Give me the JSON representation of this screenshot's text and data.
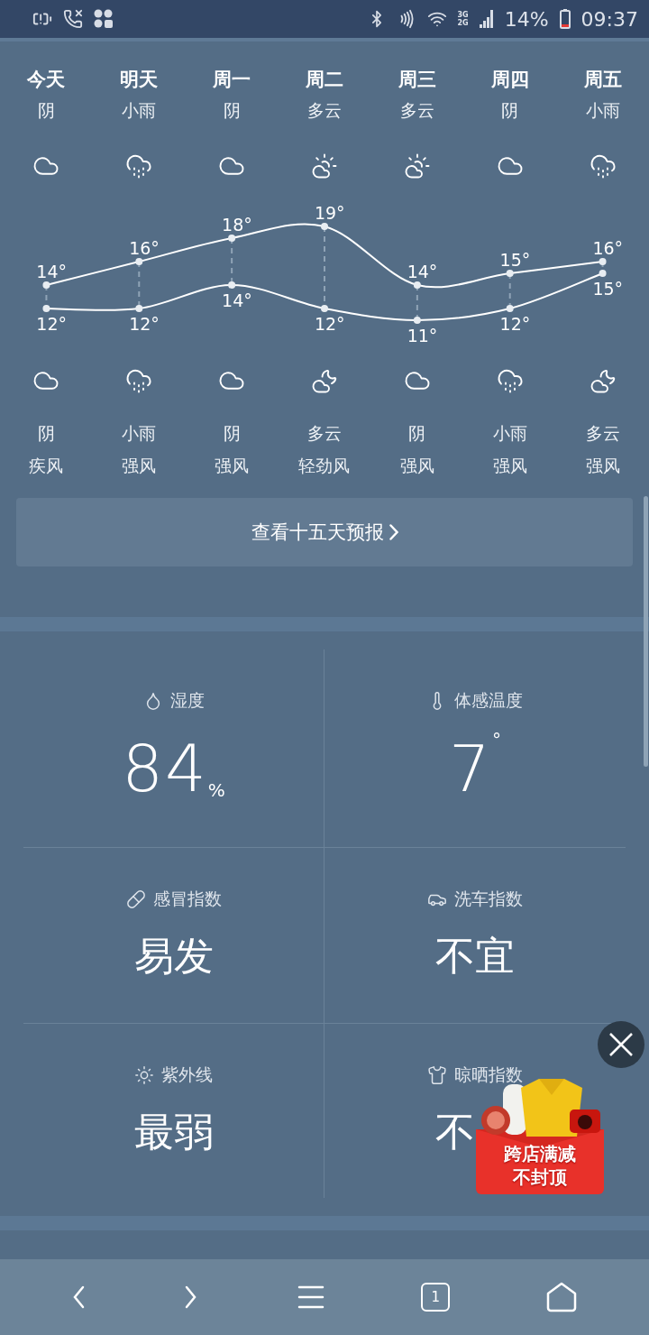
{
  "status_bar": {
    "network_labels": [
      "3G",
      "2G"
    ],
    "battery": "14%",
    "time": "09:37"
  },
  "forecast": {
    "days": [
      {
        "name": "今天",
        "day": {
          "weather": "阴",
          "kind": "cloudy"
        },
        "night": {
          "weather": "阴",
          "kind": "cloudy"
        },
        "wind": "疾风"
      },
      {
        "name": "明天",
        "day": {
          "weather": "小雨",
          "kind": "rain"
        },
        "night": {
          "weather": "小雨",
          "kind": "rain"
        },
        "wind": "强风"
      },
      {
        "name": "周一",
        "day": {
          "weather": "阴",
          "kind": "cloudy"
        },
        "night": {
          "weather": "阴",
          "kind": "cloudy"
        },
        "wind": "强风"
      },
      {
        "name": "周二",
        "day": {
          "weather": "多云",
          "kind": "partly-sun"
        },
        "night": {
          "weather": "多云",
          "kind": "partly-moon"
        },
        "wind": "轻劲风"
      },
      {
        "name": "周三",
        "day": {
          "weather": "多云",
          "kind": "partly-sun"
        },
        "night": {
          "weather": "阴",
          "kind": "cloudy"
        },
        "wind": "强风"
      },
      {
        "name": "周四",
        "day": {
          "weather": "阴",
          "kind": "cloudy"
        },
        "night": {
          "weather": "小雨",
          "kind": "rain"
        },
        "wind": "强风"
      },
      {
        "name": "周五",
        "day": {
          "weather": "小雨",
          "kind": "rain"
        },
        "night": {
          "weather": "多云",
          "kind": "partly-moon"
        },
        "wind": "强风"
      }
    ],
    "chart_data": {
      "type": "line",
      "data_labels": true,
      "series": [
        {
          "color": "#ffffff",
          "marker": "circle",
          "values": [
            14,
            16,
            18,
            19,
            14,
            15,
            16
          ]
        },
        {
          "color": "#ffffff",
          "marker": "circle",
          "values": [
            12,
            12,
            14,
            12,
            11,
            12,
            15
          ]
        }
      ]
    },
    "degree_sign": "°",
    "more_button": "查看十五天预报"
  },
  "indices": [
    {
      "label": "湿度",
      "value": "84",
      "unit": "%",
      "kind": "number"
    },
    {
      "label": "体感温度",
      "value": "7",
      "unit": "°",
      "kind": "number"
    },
    {
      "label": "感冒指数",
      "value": "易发",
      "kind": "text"
    },
    {
      "label": "洗车指数",
      "value": "不宜",
      "kind": "text"
    },
    {
      "label": "紫外线",
      "value": "最弱",
      "kind": "text"
    },
    {
      "label": "晾晒指数",
      "value": "不",
      "kind": "text"
    }
  ],
  "ad": {
    "lines": [
      "跨店满减",
      "不封顶"
    ]
  },
  "bottom_nav": {
    "tab_count": "1"
  }
}
